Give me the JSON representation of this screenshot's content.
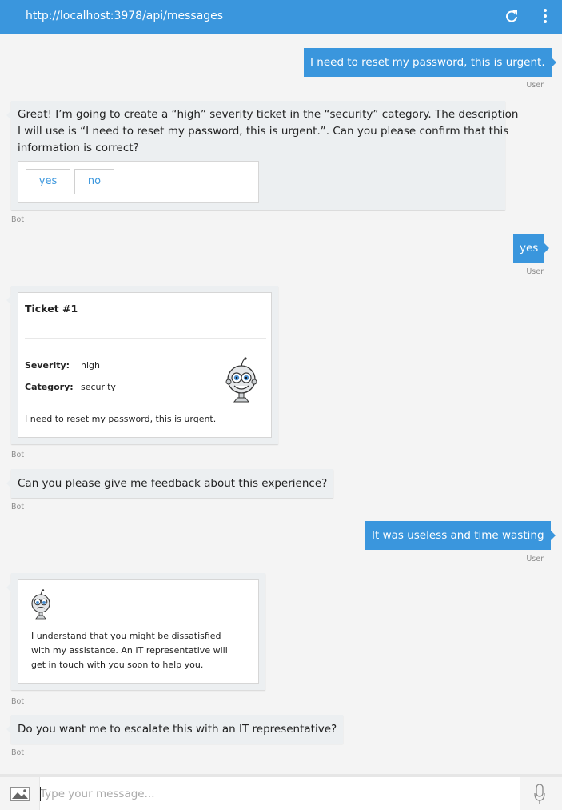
{
  "header": {
    "url": "http://localhost:3978/api/messages",
    "refresh_icon": "refresh-icon",
    "menu_icon": "more-vertical-icon"
  },
  "messages": {
    "m1": {
      "text": "I need to reset my password, this is urgent.",
      "from": "User"
    },
    "m2": {
      "line1": "Great! I’m going to create a “high” severity ticket in the “security” category. The description",
      "line2": "I will use is “I need to reset my password, this is urgent.”. Can you please confirm that this",
      "line3": "information is correct?",
      "yes_label": "yes",
      "no_label": "no",
      "from": "Bot"
    },
    "m3": {
      "text": "yes",
      "from": "User"
    },
    "m4": {
      "title": "Ticket #1",
      "severity_key": "Severity:",
      "severity_val": "high",
      "category_key": "Category:",
      "category_val": "security",
      "description": "I need to reset my password, this is urgent.",
      "from": "Bot"
    },
    "m5": {
      "text": "Can you please give me feedback about this experience?",
      "from": "Bot"
    },
    "m6": {
      "text": "It was useless and time wasting",
      "from": "User"
    },
    "m7": {
      "line1": "I understand that you might be dissatisfied",
      "line2": "with my assistance. An IT representative will",
      "line3": "get in touch with you soon to help you.",
      "from": "Bot"
    },
    "m8": {
      "text": "Do you want me to escalate this with an IT representative?",
      "from": "Bot"
    }
  },
  "composer": {
    "placeholder": "Type your message...",
    "image_icon": "image-upload-icon",
    "mic_icon": "microphone-icon"
  },
  "colors": {
    "accent": "#3a96dd",
    "bot_bubble": "#eceff1",
    "background": "#f4f4f4"
  }
}
